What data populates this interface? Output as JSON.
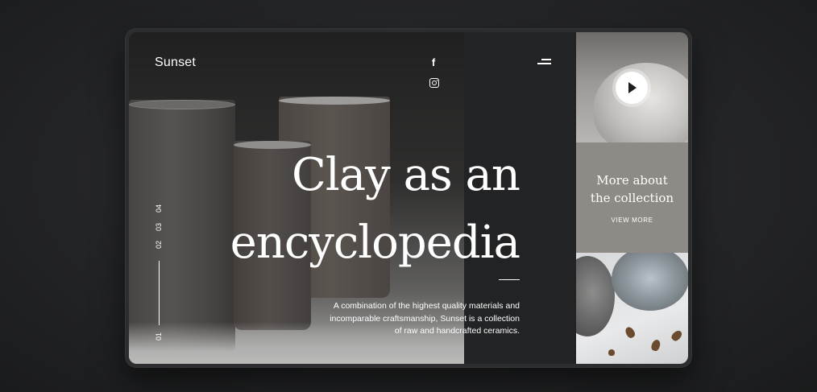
{
  "brand": "Sunset",
  "social": {
    "facebook_icon": "facebook-icon",
    "instagram_icon": "instagram-icon"
  },
  "menu_icon": "menu-icon",
  "hero": {
    "headline_line1": "Clay as an",
    "headline_line2": "encyclopedia",
    "description": "A combination of the highest quality materials and incomparable craftsmanship, Sunset is a collection of raw and handcrafted ceramics."
  },
  "pager": {
    "items": [
      "04",
      "03",
      "02",
      "01"
    ]
  },
  "sidebar": {
    "video_play_icon": "play-icon",
    "collection_title_line1": "More about",
    "collection_title_line2": "the collection",
    "view_more": "VIEW MORE"
  },
  "colors": {
    "page_bg": "#252628",
    "panel_dark": "#222325",
    "collection_tile": "#8e8a86",
    "text": "#ffffff"
  }
}
